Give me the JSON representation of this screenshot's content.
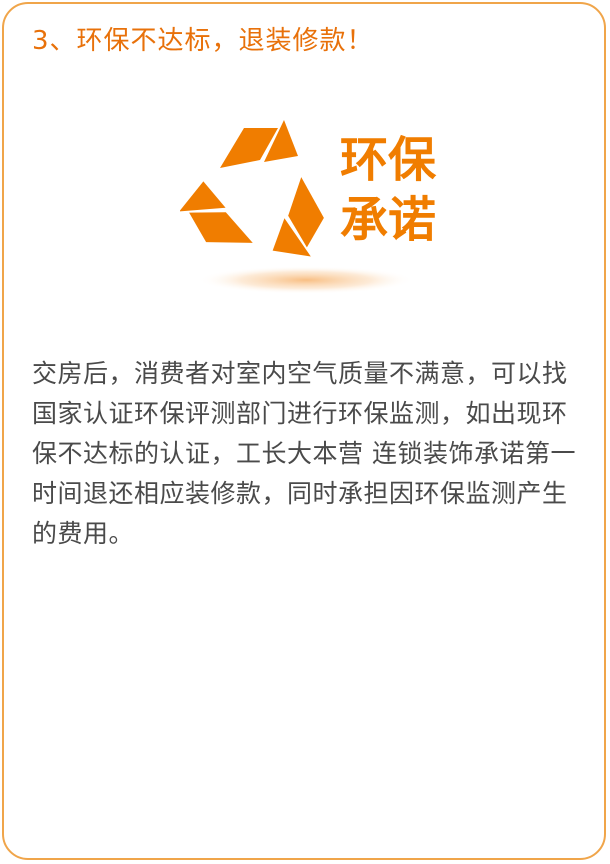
{
  "heading": "3、环保不达标，退装修款！",
  "emblem": {
    "icon": "recycle-icon",
    "line1": "环保",
    "line2": "承诺",
    "color": "#f07d00"
  },
  "body_text": "交房后，消费者对室内空气质量不满意，可以找国家认证环保评测部门进行环保监测，如出现环保不达标的认证，工长大本营 连锁装饰承诺第一时间退还相应装修款，同时承担因环保监测产生的费用。",
  "colors": {
    "accent": "#e8710a",
    "border": "#f0a54a",
    "text": "#4a4a4a"
  }
}
